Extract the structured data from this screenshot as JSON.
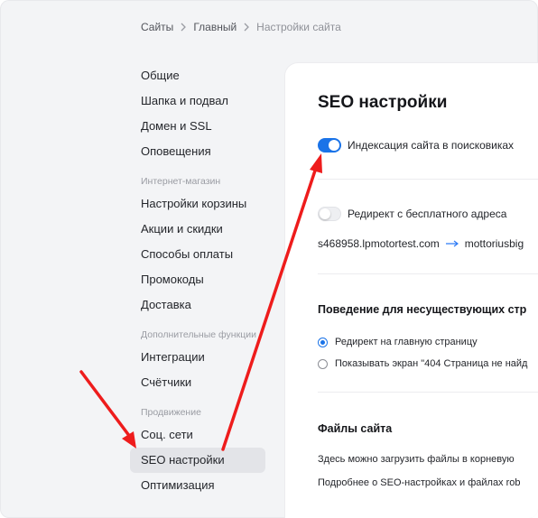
{
  "breadcrumb": {
    "items": [
      "Сайты",
      "Главный",
      "Настройки сайта"
    ]
  },
  "sidebar": {
    "items": [
      {
        "label": "Общие"
      },
      {
        "label": "Шапка и подвал"
      },
      {
        "label": "Домен и SSL"
      },
      {
        "label": "Оповещения"
      }
    ],
    "group_shop": "Интернет-магазин",
    "shop_items": [
      {
        "label": "Настройки корзины"
      },
      {
        "label": "Акции и скидки"
      },
      {
        "label": "Способы оплаты"
      },
      {
        "label": "Промокоды"
      },
      {
        "label": "Доставка"
      }
    ],
    "group_extra": "Дополнительные функции",
    "extra_items": [
      {
        "label": "Интеграции"
      },
      {
        "label": "Счётчики"
      }
    ],
    "group_promo": "Продвижение",
    "promo_items": [
      {
        "label": "Соц. сети"
      },
      {
        "label": "SEO настройки",
        "active": true
      },
      {
        "label": "Оптимизация"
      }
    ]
  },
  "main": {
    "title": "SEO настройки",
    "indexing": {
      "label": "Индексация сайта в поисковиках",
      "enabled": true
    },
    "redirect_free": {
      "label": "Редирект с бесплатного адреса",
      "enabled": false
    },
    "redirect_from": "s468958.lpmotortest.com",
    "redirect_to": "mottoriusbig",
    "not_found_section": {
      "title": "Поведение для несуществующих стр",
      "options": [
        {
          "label": "Редирект на главную страницу",
          "selected": true
        },
        {
          "label": "Показывать экран \"404 Страница не найд",
          "selected": false
        }
      ]
    },
    "files_section": {
      "title": "Файлы сайта",
      "line1": "Здесь можно загрузить файлы в корневую",
      "line2": "Подробнее о SEO-настройках и файлах rob"
    }
  },
  "colors": {
    "accent": "#1a73e8",
    "annotation_arrow": "#ee1c1c"
  }
}
